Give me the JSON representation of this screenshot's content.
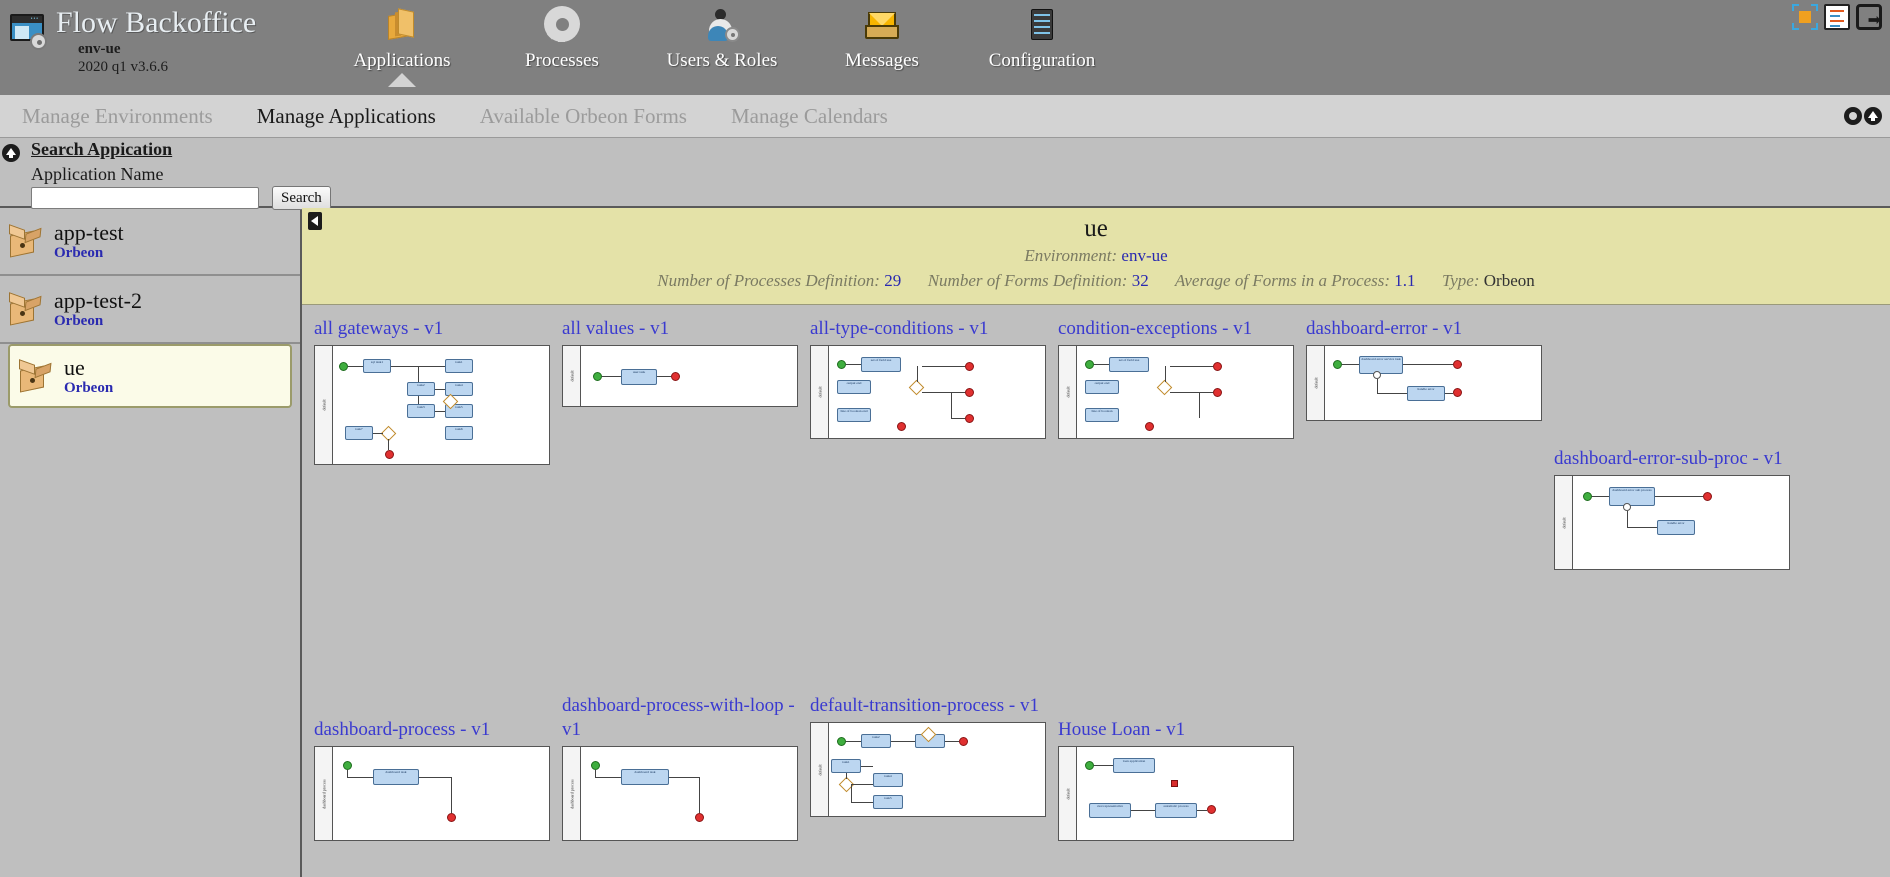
{
  "app": {
    "title": "Flow Backoffice",
    "environment": "env-ue",
    "version": "2020 q1 v3.6.6",
    "logo_icon": "window-gear-icon"
  },
  "main_nav": [
    {
      "label": "Applications",
      "icon": "package-box-icon",
      "active": true
    },
    {
      "label": "Processes",
      "icon": "gear-icon",
      "active": false
    },
    {
      "label": "Users & Roles",
      "icon": "user-gear-icon",
      "active": false
    },
    {
      "label": "Messages",
      "icon": "mail-tray-icon",
      "active": false
    },
    {
      "label": "Configuration",
      "icon": "server-rack-icon",
      "active": false
    }
  ],
  "top_right_icons": [
    {
      "name": "fullscreen-frame-icon"
    },
    {
      "name": "process-document-icon"
    },
    {
      "name": "logout-icon"
    }
  ],
  "sub_nav": {
    "items": [
      {
        "label": "Manage Environments",
        "active": false
      },
      {
        "label": "Manage Applications",
        "active": true
      },
      {
        "label": "Available Orbeon Forms",
        "active": false
      },
      {
        "label": "Manage Calendars",
        "active": false
      }
    ],
    "right_icons": [
      {
        "name": "help-icon"
      },
      {
        "name": "collapse-up-icon"
      }
    ]
  },
  "search_panel": {
    "toggle_icon": "collapse-up-icon",
    "title": "Search Appication",
    "field_label": "Application Name",
    "input_value": "",
    "input_placeholder": "",
    "button_label": "Search"
  },
  "sidebar": {
    "items": [
      {
        "name": "app-test",
        "subtitle": "Orbeon",
        "selected": false
      },
      {
        "name": "app-test-2",
        "subtitle": "Orbeon",
        "selected": false
      },
      {
        "name": "ue",
        "subtitle": "Orbeon",
        "selected": true
      }
    ]
  },
  "info_panel": {
    "collapse_icon": "collapse-left-icon",
    "title": "ue",
    "environment_label": "Environment:",
    "environment_value": "env-ue",
    "stats": [
      {
        "label": "Number of Processes Definition:",
        "value": "29"
      },
      {
        "label": "Number of Forms Definition:",
        "value": "32"
      },
      {
        "label": "Average of Forms in a Process:",
        "value": "1.1"
      },
      {
        "label": "Type:",
        "value": "Orbeon"
      }
    ]
  },
  "process_cards": [
    {
      "title": "all gateways - v1",
      "lane": "default"
    },
    {
      "title": "all values - v1",
      "lane": "default"
    },
    {
      "title": "all-type-conditions - v1",
      "lane": "default"
    },
    {
      "title": "condition-exceptions - v1",
      "lane": "default"
    },
    {
      "title": "dashboard-error - v1",
      "lane": "default"
    },
    {
      "title": "dashboard-error-sub-proc - v1",
      "lane": "default"
    },
    {
      "title": "dashboard-process - v1",
      "lane": "dashboard process"
    },
    {
      "title": "dashboard-process-with-loop - v1",
      "lane": "dashboard process"
    },
    {
      "title": "default-transition-process - v1",
      "lane": "default"
    },
    {
      "title": "House Loan - v1",
      "lane": "default"
    }
  ],
  "colors": {
    "header_bg": "#808080",
    "subnav_bg": "#d3d3d3",
    "body_bg": "#bfbfbf",
    "info_bg": "#e4e2a8",
    "link": "#3a3ad0",
    "accent_blue": "#2a2ab0"
  }
}
